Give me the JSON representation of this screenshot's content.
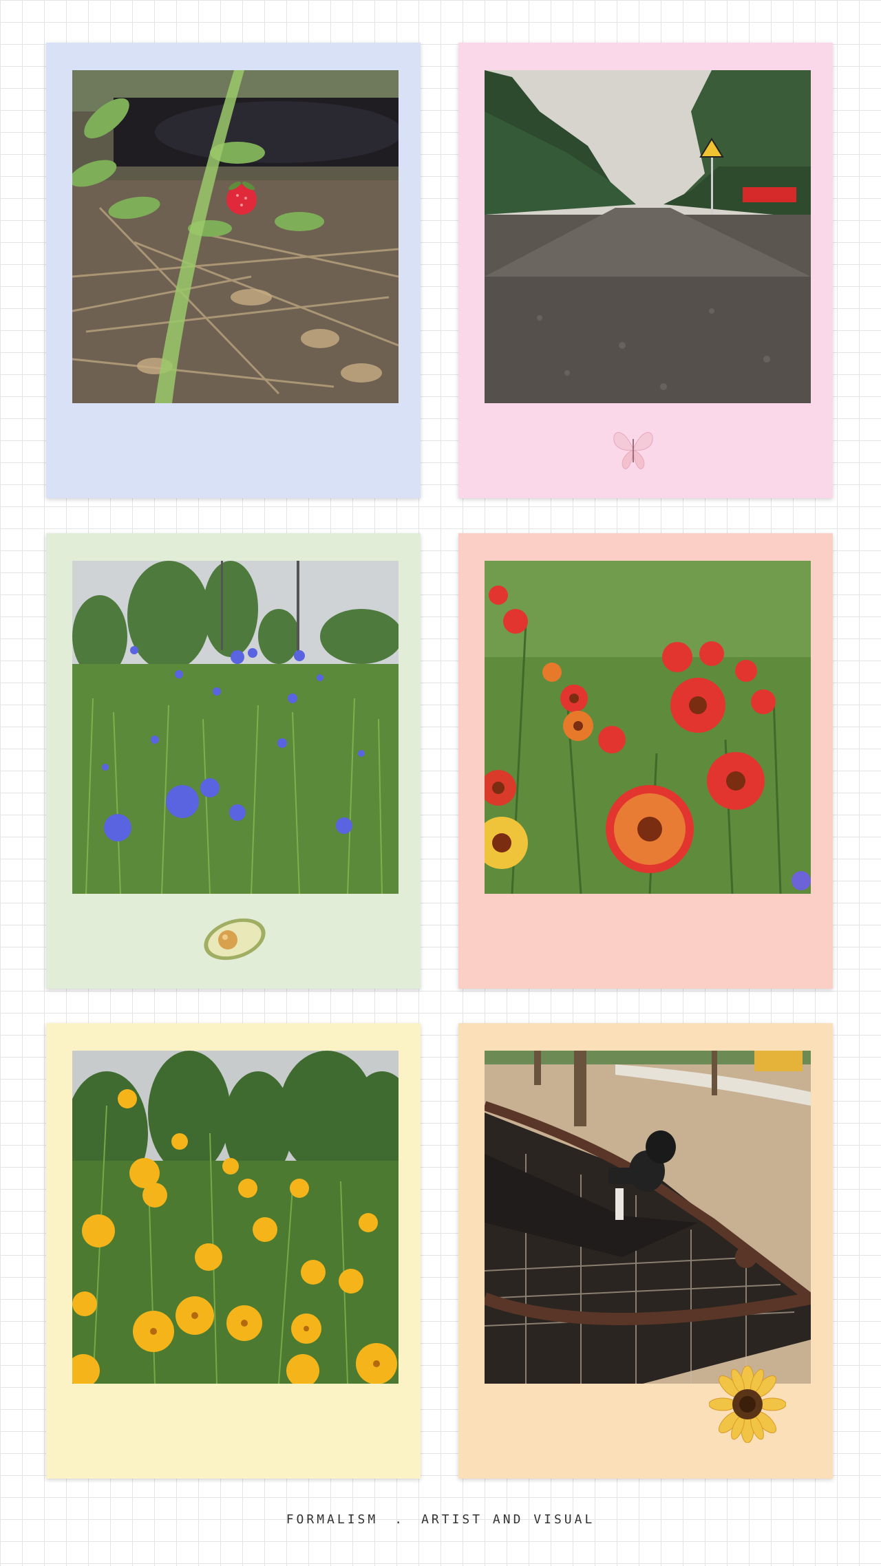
{
  "footer": {
    "left_text": "FORMALISM",
    "separator": ".",
    "right_text": "ARTIST AND VISUAL"
  },
  "colors": {
    "grid_line": "#e4e4e4",
    "card_blue": "#d9e1f6",
    "card_pink": "#fbd7ea",
    "card_green": "#e2edd8",
    "card_salmon": "#fbcfc6",
    "card_yellow": "#fbf3c5",
    "card_peach": "#fbdfb8"
  },
  "cards": [
    {
      "photo": "strawberry-in-grass-photo",
      "sticker": null
    },
    {
      "photo": "wet-road-and-trees-photo",
      "sticker": "butterfly-sticker"
    },
    {
      "photo": "blue-cornflowers-photo",
      "sticker": "avocado-sticker"
    },
    {
      "photo": "red-yellow-gaillardia-photo",
      "sticker": null
    },
    {
      "photo": "yellow-coreopsis-photo",
      "sticker": null
    },
    {
      "photo": "child-on-rope-net-slide-photo",
      "sticker": "sunflower-sticker"
    }
  ]
}
